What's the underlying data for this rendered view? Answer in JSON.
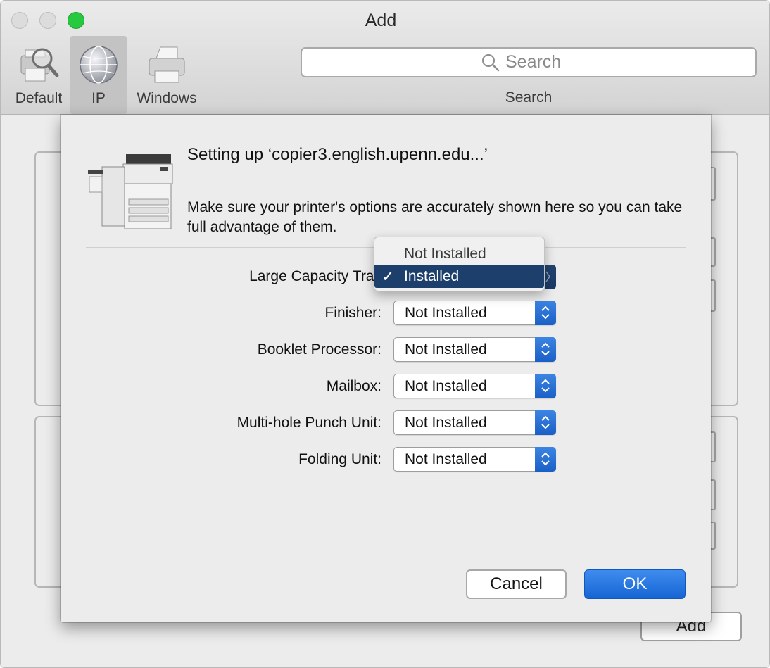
{
  "window": {
    "title": "Add"
  },
  "toolbar": {
    "items": [
      {
        "label": "Default",
        "icon": "printer-magnifier-icon"
      },
      {
        "label": "IP",
        "icon": "globe-icon"
      },
      {
        "label": "Windows",
        "icon": "windows-printer-icon"
      }
    ],
    "search": {
      "placeholder": "Search",
      "label": "Search"
    }
  },
  "background": {
    "add_button": "Add"
  },
  "sheet": {
    "title": "Setting up ‘copier3.english.upenn.edu...’",
    "message": "Make sure your printer's options are accurately shown here so you can take full advantage of them.",
    "options": [
      {
        "label": "Large Capacity Tray",
        "value": "Installed"
      },
      {
        "label": "Finisher:",
        "value": "Not Installed"
      },
      {
        "label": "Booklet Processor:",
        "value": "Not Installed"
      },
      {
        "label": "Mailbox:",
        "value": "Not Installed"
      },
      {
        "label": "Multi-hole Punch Unit:",
        "value": "Not Installed"
      },
      {
        "label": "Folding Unit:",
        "value": "Not Installed"
      }
    ],
    "dropdown_menu": {
      "items": [
        {
          "label": "Not Installed",
          "selected": false
        },
        {
          "label": "Installed",
          "selected": true
        }
      ],
      "check_glyph": "✓"
    },
    "buttons": {
      "cancel": "Cancel",
      "ok": "OK"
    }
  },
  "colors": {
    "accent": "#1a6ed8",
    "menu_highlight": "#1c3f6b",
    "zoom": "#27c93f"
  }
}
